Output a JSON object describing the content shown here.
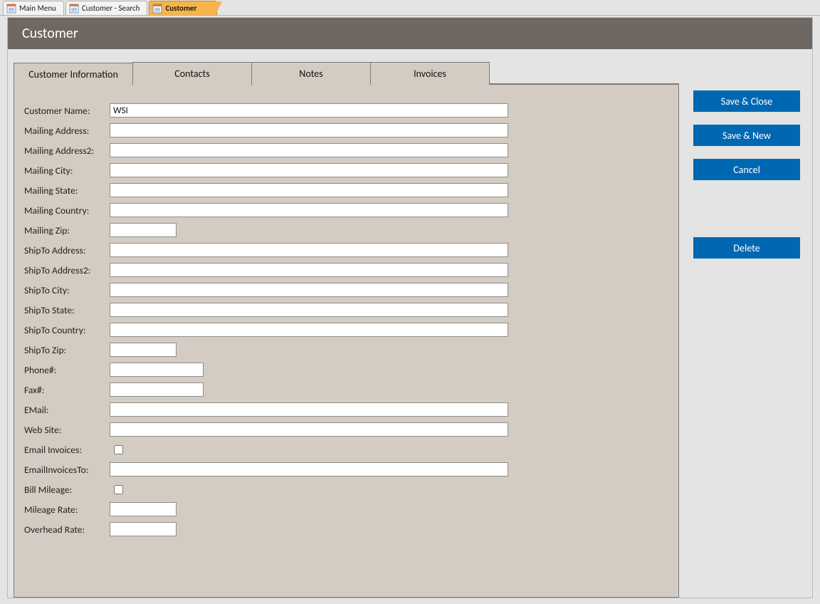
{
  "objectTabs": [
    {
      "label": "Main Menu",
      "active": false
    },
    {
      "label": "Customer - Search",
      "active": false
    },
    {
      "label": "Customer",
      "active": true
    }
  ],
  "header": {
    "title": "Customer"
  },
  "innerTabs": {
    "t1": "Customer Information",
    "t2": "Contacts",
    "t3": "Notes",
    "t4": "Invoices"
  },
  "labels": {
    "customerName": "Customer Name:",
    "mailingAddress": "Mailing Address:",
    "mailingAddress2": "Mailing Address2:",
    "mailingCity": "Mailing City:",
    "mailingState": "Mailing State:",
    "mailingCountry": "Mailing Country:",
    "mailingZip": "Mailing Zip:",
    "shipToAddress": "ShipTo Address:",
    "shipToAddress2": "ShipTo Address2:",
    "shipToCity": "ShipTo City:",
    "shipToState": "ShipTo State:",
    "shipToCountry": "ShipTo Country:",
    "shipToZip": "ShipTo Zip:",
    "phone": "Phone#:",
    "fax": "Fax#:",
    "email": "EMail:",
    "website": "Web Site:",
    "emailInvoices": "Email Invoices:",
    "emailInvoicesTo": "EmailInvoicesTo:",
    "billMileage": "Bill Mileage:",
    "mileageRate": "Mileage Rate:",
    "overheadRate": "Overhead Rate:"
  },
  "values": {
    "customerName": "WSI",
    "mailingAddress": "",
    "mailingAddress2": "",
    "mailingCity": "",
    "mailingState": "",
    "mailingCountry": "",
    "mailingZip": "",
    "shipToAddress": "",
    "shipToAddress2": "",
    "shipToCity": "",
    "shipToState": "",
    "shipToCountry": "",
    "shipToZip": "",
    "phone": "",
    "fax": "",
    "email": "",
    "website": "",
    "emailInvoices": false,
    "emailInvoicesTo": "",
    "billMileage": false,
    "mileageRate": "",
    "overheadRate": ""
  },
  "buttons": {
    "saveClose": "Save & Close",
    "saveNew": "Save & New",
    "cancel": "Cancel",
    "delete": "Delete"
  }
}
